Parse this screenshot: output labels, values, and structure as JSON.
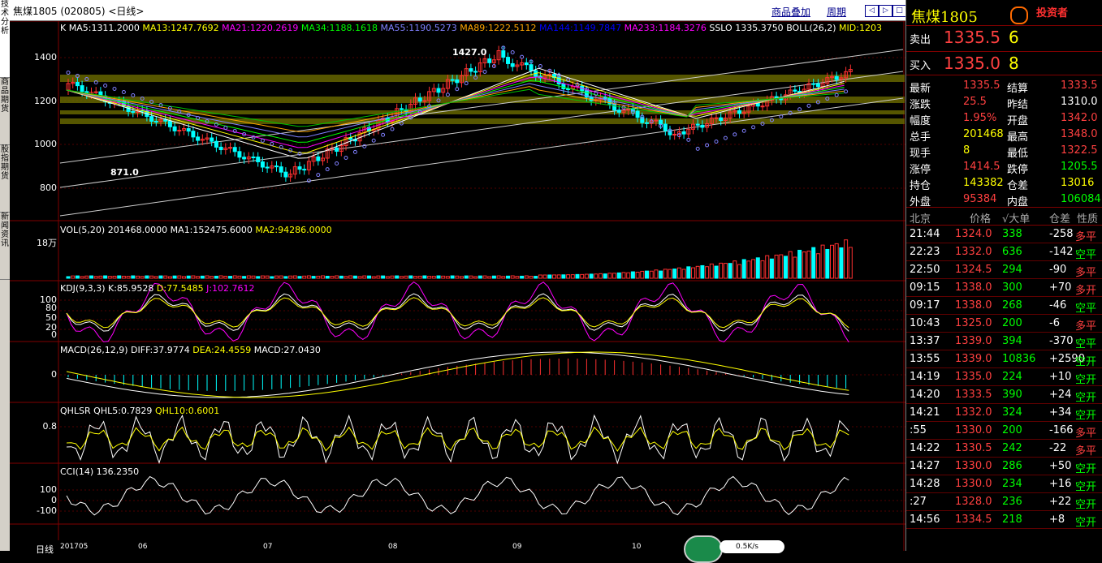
{
  "left_tabs": [
    "技术分析",
    "商品期货",
    "股指期货",
    "新闻资讯"
  ],
  "title": "焦煤1805 (020805) <日线>",
  "title_links": {
    "overlay": "商品叠加",
    "period": "周期"
  },
  "nav_buttons": [
    "◁",
    "▷",
    "□"
  ],
  "main": {
    "ma_line": [
      {
        "text": "K",
        "color": "#ffffff"
      },
      {
        "text": "MA5:1311.2000",
        "color": "#ffffff"
      },
      {
        "text": "MA13:1247.7692",
        "color": "#ffff00"
      },
      {
        "text": "MA21:1220.2619",
        "color": "#ff00ff"
      },
      {
        "text": "MA34:1188.1618",
        "color": "#00ff00"
      },
      {
        "text": "MA55:1190.5273",
        "color": "#8080ff"
      },
      {
        "text": "MA89:1222.5112",
        "color": "#ffa500"
      },
      {
        "text": "MA144:1149.7847",
        "color": "#0000ff"
      },
      {
        "text": "MA233:1184.3276",
        "color": "#ff00ff"
      },
      {
        "text": "SSLO 1335.3750",
        "color": "#ffffff"
      },
      {
        "text": "BOLL(26,2)",
        "color": "#ffffff"
      },
      {
        "text": "MID:1203",
        "color": "#ffff00"
      }
    ],
    "y_ticks": [
      "1400",
      "1200",
      "1000",
      "800"
    ],
    "high_label": "1427.0",
    "low_label": "871.0"
  },
  "vol": {
    "legend": [
      {
        "text": "VOL(5,20) 201468.0000",
        "color": "#ffffff"
      },
      {
        "text": "MA1:152475.6000",
        "color": "#ffffff"
      },
      {
        "text": "MA2:94286.0000",
        "color": "#ffff00"
      }
    ],
    "y_tick": "18万"
  },
  "kdj": {
    "legend": [
      {
        "text": "KDJ(9,3,3) K:85.9528",
        "color": "#ffffff"
      },
      {
        "text": "D:77.5485",
        "color": "#ffff00"
      },
      {
        "text": "J:102.7612",
        "color": "#ff00ff"
      }
    ],
    "y_ticks": [
      "100",
      "80",
      "50",
      "20",
      "0"
    ]
  },
  "macd": {
    "legend": [
      {
        "text": "MACD(26,12,9) DIFF:37.9774",
        "color": "#ffffff"
      },
      {
        "text": "DEA:24.4559",
        "color": "#ffff00"
      },
      {
        "text": "MACD:27.0430",
        "color": "#ffffff"
      }
    ],
    "y_tick": "0"
  },
  "qhlsr": {
    "legend": [
      {
        "text": "QHLSR QHL5:0.7829",
        "color": "#ffffff"
      },
      {
        "text": "QHL10:0.6001",
        "color": "#ffff00"
      }
    ],
    "y_tick": "0.8"
  },
  "cci": {
    "legend": [
      {
        "text": "CCI(14) 136.2350",
        "color": "#ffffff"
      }
    ],
    "y_ticks": [
      "100",
      "0",
      "-100"
    ]
  },
  "x_axis": {
    "prefix": "日线",
    "labels": [
      "201705",
      "06",
      "07",
      "08",
      "09",
      "10"
    ]
  },
  "panel": {
    "name": "焦煤1805",
    "sell_label": "卖出",
    "sell_price": "1335.5",
    "sell_qty": "6",
    "buy_label": "买入",
    "buy_price": "1335.0",
    "buy_qty": "8",
    "stats": [
      {
        "l1": "最新",
        "v1": "1335.5",
        "c1": "#ff4040",
        "l2": "结算",
        "v2": "1333.5",
        "c2": "#ff4040"
      },
      {
        "l1": "涨跌",
        "v1": "25.5",
        "c1": "#ff4040",
        "l2": "昨结",
        "v2": "1310.0",
        "c2": "#ffffff"
      },
      {
        "l1": "幅度",
        "v1": "1.95%",
        "c1": "#ff4040",
        "l2": "开盘",
        "v2": "1342.0",
        "c2": "#ff4040"
      },
      {
        "l1": "总手",
        "v1": "201468",
        "c1": "#ffff00",
        "l2": "最高",
        "v2": "1348.0",
        "c2": "#ff4040"
      },
      {
        "l1": "现手",
        "v1": "8",
        "c1": "#ffff00",
        "l2": "最低",
        "v2": "1322.5",
        "c2": "#ff4040"
      },
      {
        "l1": "涨停",
        "v1": "1414.5",
        "c1": "#ff4040",
        "l2": "跌停",
        "v2": "1205.5",
        "c2": "#00ff00"
      },
      {
        "l1": "持仓",
        "v1": "143382",
        "c1": "#ffff00",
        "l2": "仓差",
        "v2": "13016",
        "c2": "#ffff00"
      },
      {
        "l1": "外盘",
        "v1": "95384",
        "c1": "#ff4040",
        "l2": "内盘",
        "v2": "106084",
        "c2": "#00ff00"
      }
    ],
    "ticks_header": [
      "北京",
      "价格",
      "√大单",
      "仓差",
      "性质"
    ],
    "ticks": [
      {
        "t": "21:44",
        "p": "1324.0",
        "v": "338",
        "d": "-258",
        "n": "多平",
        "nc": "#ff4040"
      },
      {
        "t": "22:23",
        "p": "1332.0",
        "v": "636",
        "d": "-142",
        "n": "空平",
        "nc": "#00ff00"
      },
      {
        "t": "22:50",
        "p": "1324.5",
        "v": "294",
        "d": "-90",
        "n": "多平",
        "nc": "#ff4040"
      },
      {
        "t": "09:15",
        "p": "1338.0",
        "v": "300",
        "d": "+70",
        "n": "多开",
        "nc": "#ff4040"
      },
      {
        "t": "09:17",
        "p": "1338.0",
        "v": "268",
        "d": "-46",
        "n": "空平",
        "nc": "#00ff00"
      },
      {
        "t": "10:43",
        "p": "1325.0",
        "v": "200",
        "d": "-6",
        "n": "多平",
        "nc": "#ff4040"
      },
      {
        "t": "13:37",
        "p": "1339.0",
        "v": "394",
        "d": "-370",
        "n": "空平",
        "nc": "#00ff00"
      },
      {
        "t": "13:55",
        "p": "1339.0",
        "v": "10836",
        "d": "+2590",
        "n": "空开",
        "nc": "#00ff00"
      },
      {
        "t": "14:19",
        "p": "1335.0",
        "v": "224",
        "d": "+10",
        "n": "空开",
        "nc": "#00ff00"
      },
      {
        "t": "14:20",
        "p": "1333.5",
        "v": "390",
        "d": "+24",
        "n": "空开",
        "nc": "#00ff00"
      },
      {
        "t": "14:21",
        "p": "1332.0",
        "v": "324",
        "d": "+34",
        "n": "空开",
        "nc": "#00ff00"
      },
      {
        "t": ":55",
        "p": "1330.0",
        "v": "200",
        "d": "-166",
        "n": "多平",
        "nc": "#ff4040"
      },
      {
        "t": "14:22",
        "p": "1330.5",
        "v": "242",
        "d": "-22",
        "n": "多平",
        "nc": "#ff4040"
      },
      {
        "t": "14:27",
        "p": "1330.0",
        "v": "286",
        "d": "+50",
        "n": "空开",
        "nc": "#00ff00"
      },
      {
        "t": "14:28",
        "p": "1330.0",
        "v": "234",
        "d": "+16",
        "n": "空开",
        "nc": "#00ff00"
      },
      {
        "t": ":27",
        "p": "1328.0",
        "v": "236",
        "d": "+22",
        "n": "空开",
        "nc": "#00ff00"
      },
      {
        "t": "14:56",
        "p": "1334.5",
        "v": "218",
        "d": "+8",
        "n": "空开",
        "nc": "#00ff00"
      }
    ],
    "watermark": "投资者"
  },
  "status": {
    "net_speed": "0.5K/s"
  }
}
